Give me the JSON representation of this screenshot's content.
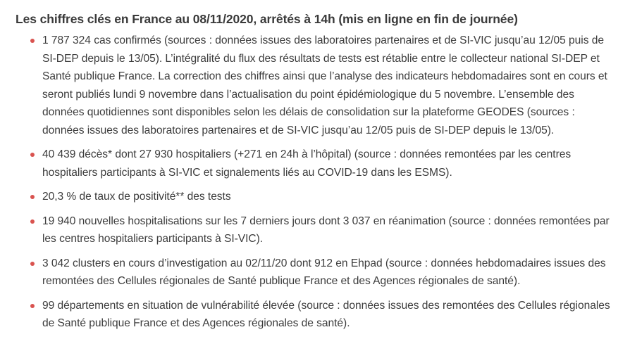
{
  "title": "Les chiffres clés en France au 08/11/2020, arrêtés à 14h (mis en ligne en fin de journée)",
  "bullet_color": "#d9534f",
  "items": [
    "1 787 324 cas confirmés (sources : données issues des laboratoires partenaires et de SI-VIC jusqu’au 12/05 puis de SI-DEP depuis le 13/05). L’intégralité du flux des résultats de tests est rétablie entre le collecteur national SI-DEP et Santé publique France. La correction des chiffres ainsi que l’analyse des indicateurs hebdomadaires sont en cours et seront publiés lundi 9 novembre dans l’actualisation du point épidémiologique du 5 novembre. L’ensemble des données quotidiennes sont disponibles selon les délais de consolidation sur la plateforme GEODES (sources : données issues des laboratoires partenaires et de SI-VIC jusqu’au 12/05 puis de SI-DEP depuis le 13/05).",
    "40 439 décès* dont 27 930 hospitaliers (+271 en 24h à l’hôpital) (source : données remontées par les centres hospitaliers participants à SI-VIC et signalements liés au COVID-19 dans les ESMS).",
    "20,3 % de taux de positivité** des tests",
    "19 940 nouvelles hospitalisations sur les 7 derniers jours dont 3 037 en réanimation (source : données remontées par les centres hospitaliers participants à SI-VIC).",
    "3 042 clusters en cours d’investigation au 02/11/20 dont 912 en Ehpad (source : données hebdomadaires issues des remontées des Cellules régionales de Santé publique France et des Agences régionales de santé).",
    "99 départements en situation de vulnérabilité élevée (source : données issues des remontées des Cellules régionales de Santé publique France et des Agences régionales de santé)."
  ]
}
